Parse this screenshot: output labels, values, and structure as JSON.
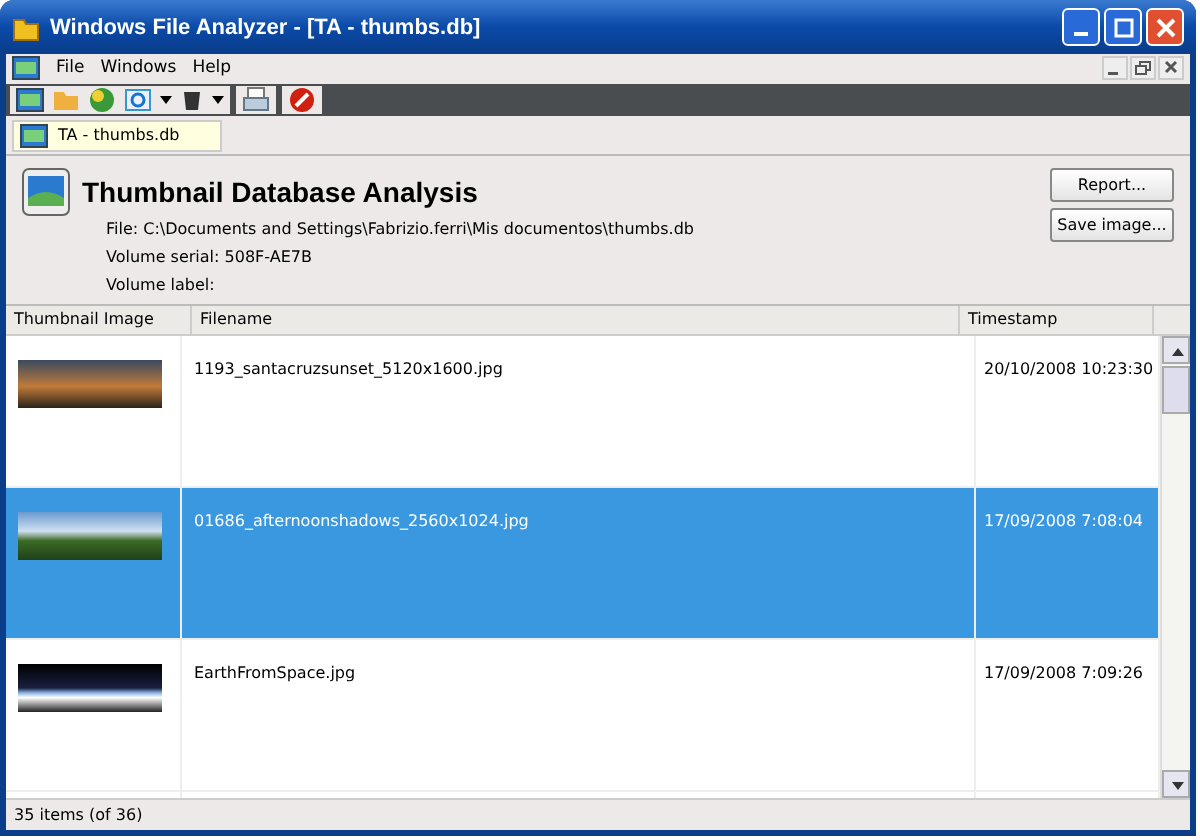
{
  "window": {
    "title": "Windows File Analyzer - [TA - thumbs.db]"
  },
  "menu": [
    "File",
    "Windows",
    "Help"
  ],
  "document_tab": {
    "label": "TA - thumbs.db"
  },
  "header": {
    "title": "Thumbnail Database Analysis",
    "file": "File: C:\\Documents and Settings\\Fabrizio.ferri\\Mis documentos\\thumbs.db",
    "serial": "Volume serial: 508F-AE7B",
    "label": "Volume label:",
    "buttons": [
      "Report...",
      "Save image..."
    ]
  },
  "table": {
    "columns": [
      "Thumbnail Image",
      "Filename",
      "Timestamp"
    ],
    "rows": [
      {
        "filename": "1193_santacruzsunset_5120x1600.jpg",
        "timestamp": "20/10/2008 10:23:30",
        "selected": false
      },
      {
        "filename": "01686_afternoonshadows_2560x1024.jpg",
        "timestamp": "17/09/2008 7:08:04",
        "selected": true
      },
      {
        "filename": "EarthFromSpace.jpg",
        "timestamp": "17/09/2008 7:09:26",
        "selected": false
      },
      {
        "selected": false
      }
    ]
  },
  "status_bar": "35 items (of 36)"
}
